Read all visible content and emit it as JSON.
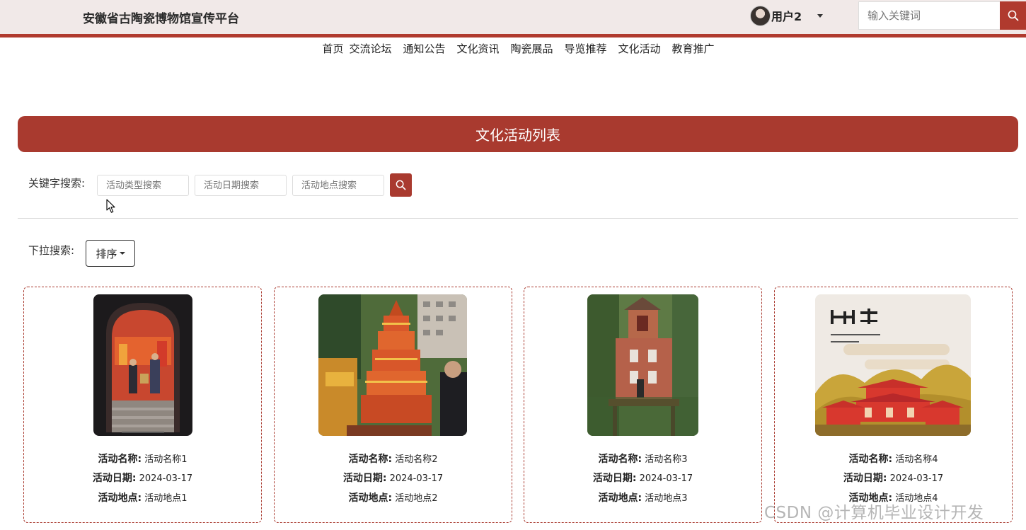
{
  "header": {
    "site_title": "安徽省古陶瓷博物馆宣传平台",
    "user_name": "用户2",
    "search_placeholder": "输入关键词",
    "accent_color": "#b03a2e",
    "bar_color": "#f1e9e8"
  },
  "nav": {
    "items": [
      "首页",
      "交流论坛",
      "通知公告",
      "文化资讯",
      "陶瓷展品",
      "导览推荐",
      "文化活动",
      "教育推广"
    ]
  },
  "page": {
    "title": "文化活动列表"
  },
  "filters": {
    "keyword_label": "关键字搜索:",
    "type_placeholder": "活动类型搜索",
    "date_placeholder": "活动日期搜索",
    "place_placeholder": "活动地点搜索",
    "search_icon": "search-icon",
    "dropdown_label": "下拉搜索:",
    "sort_label": "排序"
  },
  "labels": {
    "name": "活动名称:",
    "date": "活动日期:",
    "place": "活动地点:"
  },
  "activities": [
    {
      "name": "活动名称1",
      "date": "2024-03-17",
      "place": "活动地点1"
    },
    {
      "name": "活动名称2",
      "date": "2024-03-17",
      "place": "活动地点2"
    },
    {
      "name": "活动名称3",
      "date": "2024-03-17",
      "place": "活动地点3"
    },
    {
      "name": "活动名称4",
      "date": "2024-03-17",
      "place": "活动地点4"
    }
  ],
  "watermark": "CSDN @计算机毕业设计开发"
}
